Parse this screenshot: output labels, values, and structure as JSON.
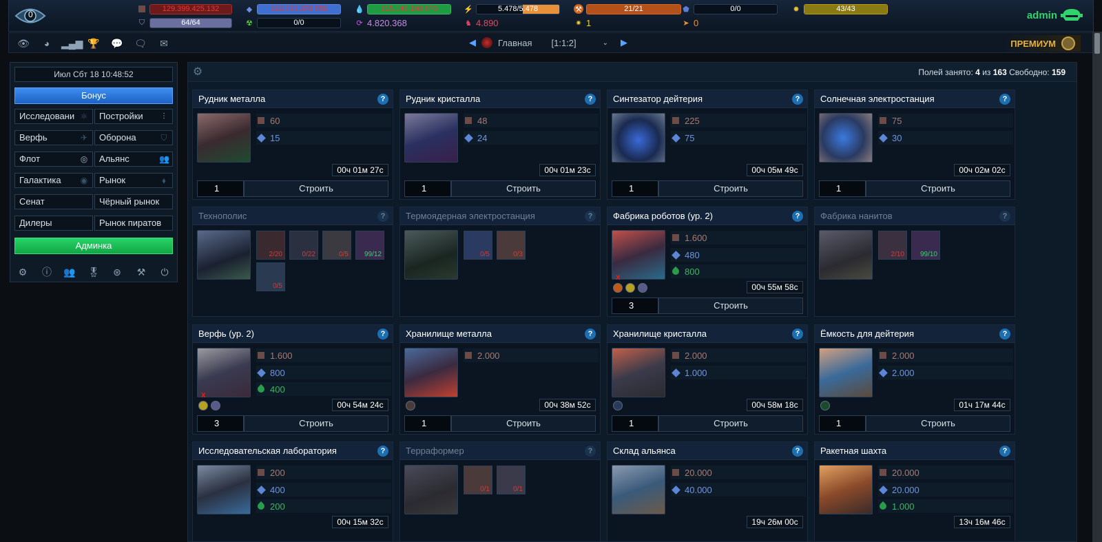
{
  "topbar": {
    "messages_count": "0",
    "metal": {
      "value": "129.399.425.132",
      "color": "#b02424"
    },
    "crystal": {
      "value": "120.799.370.558",
      "color": "#3b6fd0"
    },
    "deuterium": {
      "value": "125.148.198.873",
      "color": "#1f9b43"
    },
    "energy": {
      "value": "5.478",
      "max": "5.478",
      "fill": 0.55
    },
    "slots_orange": {
      "value": "21/21",
      "fill": 1.0
    },
    "slots_blue": {
      "value": "0/0",
      "fill": 0.0
    },
    "slots_gold": {
      "value": "43/43",
      "fill": 1.0
    },
    "shield": {
      "value": "64/64",
      "fill": 1.0
    },
    "radiation": {
      "value": "0/0"
    },
    "cycle_value": "4.820.368",
    "pink_value": "4.890",
    "yellow_value": "1",
    "orange_value": "0",
    "user": "admin"
  },
  "nav": {
    "icons": [
      "eye-icon",
      "pie-icon",
      "stats-icon",
      "trophy-icon",
      "chat-icon",
      "chats-icon",
      "mail-icon"
    ],
    "planet_name": "Главная",
    "planet_coords": "[1:1:2]",
    "premium": "ПРЕМИУМ"
  },
  "sidebar": {
    "clock": "Июл Сбт 18 10:48:52",
    "bonus": "Бонус",
    "items": [
      {
        "label": "Исследовани",
        "icon": "atom-icon"
      },
      {
        "label": "Постройки",
        "icon": "sliders-icon"
      },
      {
        "label": "Верфь",
        "icon": "ship-icon"
      },
      {
        "label": "Оборона",
        "icon": "shield-icon"
      },
      {
        "label": "Флот",
        "icon": "target-icon"
      },
      {
        "label": "Альянс",
        "icon": "group-icon"
      },
      {
        "label": "Галактика",
        "icon": "galaxy-icon"
      },
      {
        "label": "Рынок",
        "icon": "tag-icon"
      },
      {
        "label": "Сенат",
        "icon": ""
      },
      {
        "label": "Чёрный рынок",
        "icon": ""
      },
      {
        "label": "Дилеры",
        "icon": ""
      },
      {
        "label": "Рынок пиратов",
        "icon": ""
      }
    ],
    "adminka": "Админка",
    "bottom_icons": [
      "gear-icon",
      "info-icon",
      "users-icon",
      "medal-icon",
      "lifebuoy-icon",
      "tools-icon",
      "power-icon"
    ]
  },
  "main": {
    "fields_label": "Полей занято:",
    "fields_used": "4",
    "fields_of": "из",
    "fields_total": "163",
    "free_label": "Свободно:",
    "free": "159",
    "build_label": "Строить",
    "cards": [
      {
        "title": "Рудник металла",
        "metal": "60",
        "crystal": "15",
        "time": "00ч 01м 27с",
        "qty": "1"
      },
      {
        "title": "Рудник кристалла",
        "metal": "48",
        "crystal": "24",
        "time": "00ч 01м 23с",
        "qty": "1"
      },
      {
        "title": "Синтезатор дейтерия",
        "metal": "225",
        "crystal": "75",
        "time": "00ч 05м 49с",
        "qty": "1"
      },
      {
        "title": "Солнечная электростанция",
        "metal": "75",
        "crystal": "30",
        "time": "00ч 02м 02с",
        "qty": "1"
      },
      {
        "title": "Технополис",
        "reqs": [
          "2/20",
          "0/22",
          "0/5",
          "99/12",
          "0/5"
        ]
      },
      {
        "title": "Термоядерная электростанция",
        "reqs": [
          "0/5",
          "0/3"
        ]
      },
      {
        "title": "Фабрика роботов (ур. 2)",
        "metal": "1.600",
        "crystal": "480",
        "deut": "800",
        "time": "00ч 55м 58с",
        "qty": "3"
      },
      {
        "title": "Фабрика нанитов",
        "reqs": [
          "2/10",
          "99/10"
        ]
      },
      {
        "title": "Верфь (ур. 2)",
        "metal": "1.600",
        "crystal": "800",
        "deut": "400",
        "time": "00ч 54м 24с",
        "qty": "3"
      },
      {
        "title": "Хранилище металла",
        "metal": "2.000",
        "time": "00ч 38м 52с",
        "qty": "1"
      },
      {
        "title": "Хранилище кристалла",
        "metal": "2.000",
        "crystal": "1.000",
        "time": "00ч 58м 18с",
        "qty": "1"
      },
      {
        "title": "Ёмкость для дейтерия",
        "metal": "2.000",
        "crystal": "2.000",
        "time": "01ч 17м 44с",
        "qty": "1"
      },
      {
        "title": "Исследовательская лаборатория",
        "metal": "200",
        "crystal": "400",
        "deut": "200",
        "time": "00ч 15м 32с"
      },
      {
        "title": "Терраформер",
        "reqs": [
          "0/1",
          "0/1"
        ]
      },
      {
        "title": "Склад альянса",
        "metal": "20.000",
        "crystal": "40.000",
        "time": "19ч 26м 00с"
      },
      {
        "title": "Ракетная шахта",
        "metal": "20.000",
        "crystal": "20.000",
        "deut": "1.000",
        "time": "13ч 16м 46с"
      }
    ]
  }
}
